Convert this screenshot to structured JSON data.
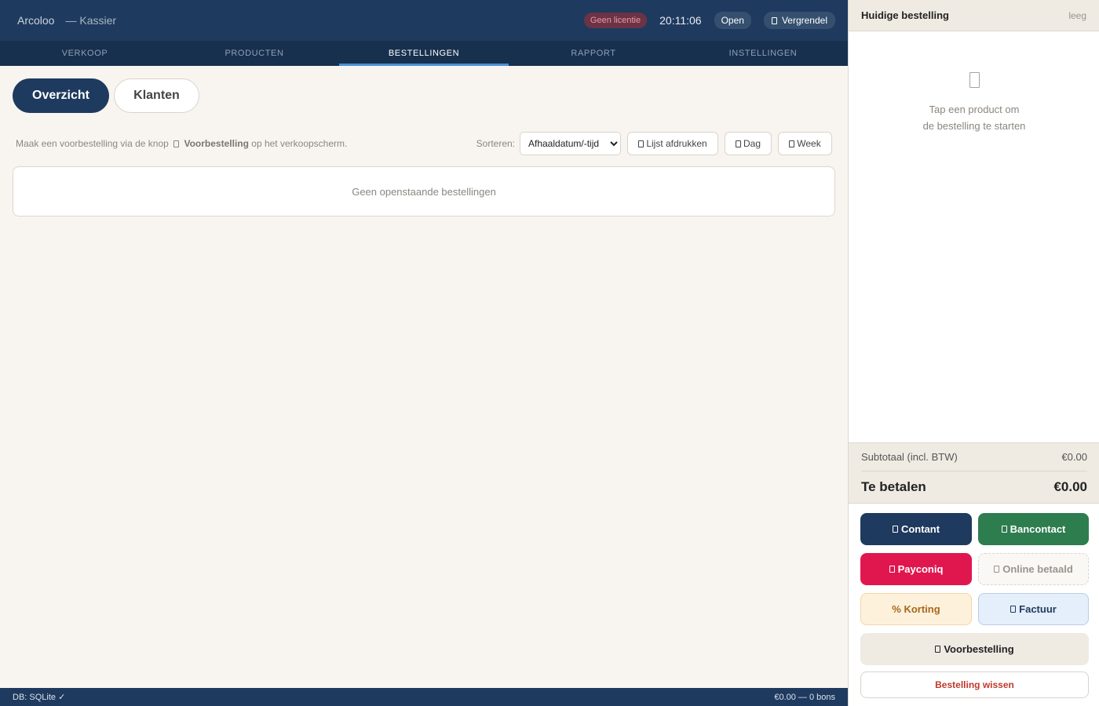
{
  "header": {
    "app_name": "Arcoloo",
    "role": "— Kassier",
    "license_badge": "Geen licentie",
    "clock": "20:11:06",
    "status": "Open",
    "lock_label": "Vergrendel"
  },
  "nav": {
    "tabs": [
      {
        "label": "VERKOOP",
        "active": false
      },
      {
        "label": "PRODUCTEN",
        "active": false
      },
      {
        "label": "BESTELLINGEN",
        "active": true
      },
      {
        "label": "RAPPORT",
        "active": false
      },
      {
        "label": "INSTELLINGEN",
        "active": false
      }
    ]
  },
  "subtabs": {
    "overview": "Overzicht",
    "customers": "Klanten"
  },
  "toolbar": {
    "hint_prefix": "Maak een voorbestelling via de knop",
    "hint_bold": "Voorbestelling",
    "hint_suffix": "op het verkoopscherm.",
    "sort_label": "Sorteren:",
    "sort_selected": "Afhaaldatum/-tijd",
    "print_label": "Lijst afdrukken",
    "day_label": "Dag",
    "week_label": "Week"
  },
  "orders": {
    "empty_text": "Geen openstaande bestellingen"
  },
  "statusbar": {
    "db": "DB: SQLite ✓",
    "summary": "€0.00 — 0 bons"
  },
  "order_panel": {
    "title": "Huidige bestelling",
    "clear_label": "leeg",
    "empty_line1": "Tap een product om",
    "empty_line2": "de bestelling te starten",
    "subtotal_label": "Subtotaal (incl. BTW)",
    "subtotal_value": "€0.00",
    "total_label": "Te betalen",
    "total_value": "€0.00",
    "buttons": {
      "cash": "Contant",
      "bancontact": "Bancontact",
      "payconiq": "Payconiq",
      "online": "Online betaald",
      "discount": "% Korting",
      "invoice": "Factuur",
      "preorder": "Voorbestelling",
      "wipe": "Bestelling wissen"
    }
  },
  "colors": {
    "primary": "#1f3a5f",
    "background": "#f8f5f0",
    "active_tab_indicator": "#4a90d9",
    "bancontact": "#2e7d4f",
    "payconiq": "#e0174f",
    "danger": "#c0392b"
  }
}
